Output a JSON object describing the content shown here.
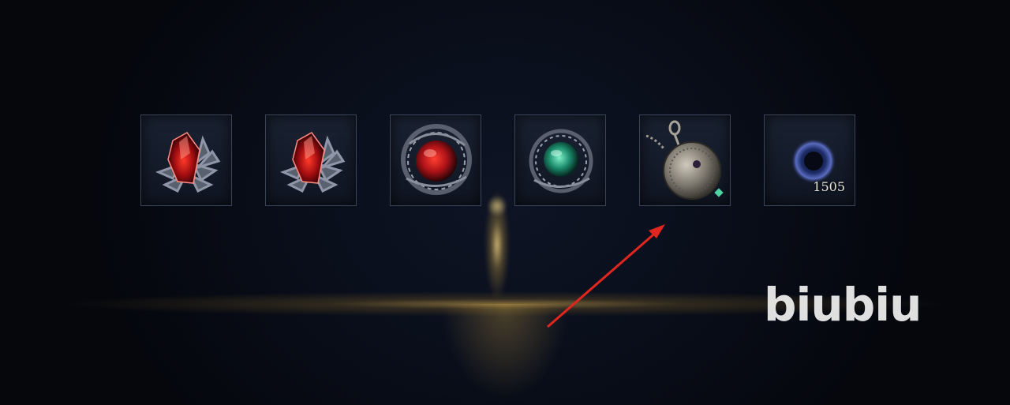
{
  "items": [
    {
      "id": "slot-1",
      "icon": "red-crystal-shard-icon"
    },
    {
      "id": "slot-2",
      "icon": "red-crystal-shard-icon"
    },
    {
      "id": "slot-3",
      "icon": "red-orb-thorn-nest-icon"
    },
    {
      "id": "slot-4",
      "icon": "green-orb-thorn-nest-icon"
    },
    {
      "id": "slot-5",
      "icon": "silver-pocket-watch-icon"
    },
    {
      "id": "slot-6",
      "icon": "dark-blue-orb-icon",
      "quantity": "1505"
    }
  ],
  "annotation": {
    "color": "#e0261f",
    "points_to": "slot-5"
  },
  "watermark": {
    "text": "biubiu"
  },
  "colors": {
    "glow": "#dcaf50",
    "slot_border": "#3a4458",
    "background": "#05070d"
  }
}
